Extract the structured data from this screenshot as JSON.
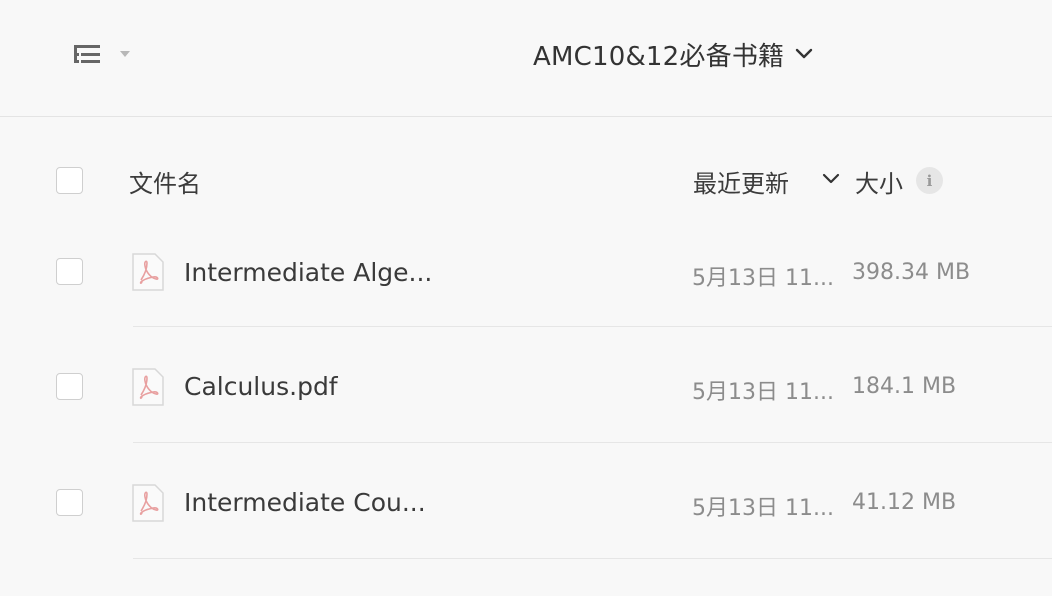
{
  "header": {
    "view_toggle_icon": "list-view-icon",
    "dropdown_icon": "caret-down-icon",
    "folder_title": "AMC10&12必备书籍",
    "folder_title_icon": "chevron-down-icon"
  },
  "columns": {
    "name": "文件名",
    "modified": "最近更新",
    "sort_icon": "chevron-down-icon",
    "size": "大小",
    "info": "i",
    "info_icon": "info-icon"
  },
  "files": [
    {
      "icon": "pdf-file-icon",
      "name": "Intermediate Alge...",
      "modified": "5月13日 11...",
      "size": "398.34 MB"
    },
    {
      "icon": "pdf-file-icon",
      "name": "Calculus.pdf",
      "modified": "5月13日 11...",
      "size": "184.1 MB"
    },
    {
      "icon": "pdf-file-icon",
      "name": "Intermediate Cou...",
      "modified": "5月13日 11...",
      "size": "41.12 MB"
    }
  ],
  "colors": {
    "background": "#f8f8f8",
    "pdf_accent": "#e8a0a0",
    "text_primary": "#3a3a3a",
    "text_secondary": "#8c8c8c"
  }
}
